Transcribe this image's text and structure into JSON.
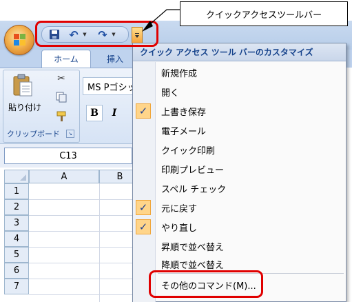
{
  "callout": {
    "text": "クイックアクセスツールバー"
  },
  "qat": {
    "items": [
      "save-icon",
      "undo-icon",
      "redo-icon"
    ],
    "undo_glyph": "↶",
    "redo_glyph": "↷",
    "drop_glyph": "▼"
  },
  "ribbon": {
    "tabs": [
      "ホーム",
      "挿入"
    ],
    "clipboard": {
      "paste_label": "貼り付け",
      "group_label": "クリップボード",
      "launcher_glyph": "↘",
      "cut_glyph": "✂"
    },
    "font": {
      "name": "MS Pゴシック",
      "bold_label": "B",
      "italic_label": "I"
    }
  },
  "namebox": {
    "value": "C13"
  },
  "grid": {
    "columns": [
      "A",
      "B"
    ],
    "rows": [
      "1",
      "2",
      "3",
      "4",
      "5",
      "6",
      "7"
    ]
  },
  "menu": {
    "title": "クイック アクセス ツール バーのカスタマイズ",
    "check_glyph": "✓",
    "items": [
      {
        "label": "新規作成",
        "checked": false
      },
      {
        "label": "開く",
        "checked": false
      },
      {
        "label": "上書き保存",
        "checked": true
      },
      {
        "label": "電子メール",
        "checked": false
      },
      {
        "label": "クイック印刷",
        "checked": false
      },
      {
        "label": "印刷プレビュー",
        "checked": false
      },
      {
        "label": "スペル チェック",
        "checked": false
      },
      {
        "label": "元に戻す",
        "checked": true
      },
      {
        "label": "やり直し",
        "checked": true
      },
      {
        "label": "昇順で並べ替え",
        "checked": false
      },
      {
        "label": "降順で並べ替え",
        "checked": false
      }
    ],
    "more_commands": "その他のコマンド(M)..."
  },
  "colors": {
    "highlight": "#e00000",
    "ribbon_text": "#15428b",
    "check_background": "#ffd58a"
  }
}
